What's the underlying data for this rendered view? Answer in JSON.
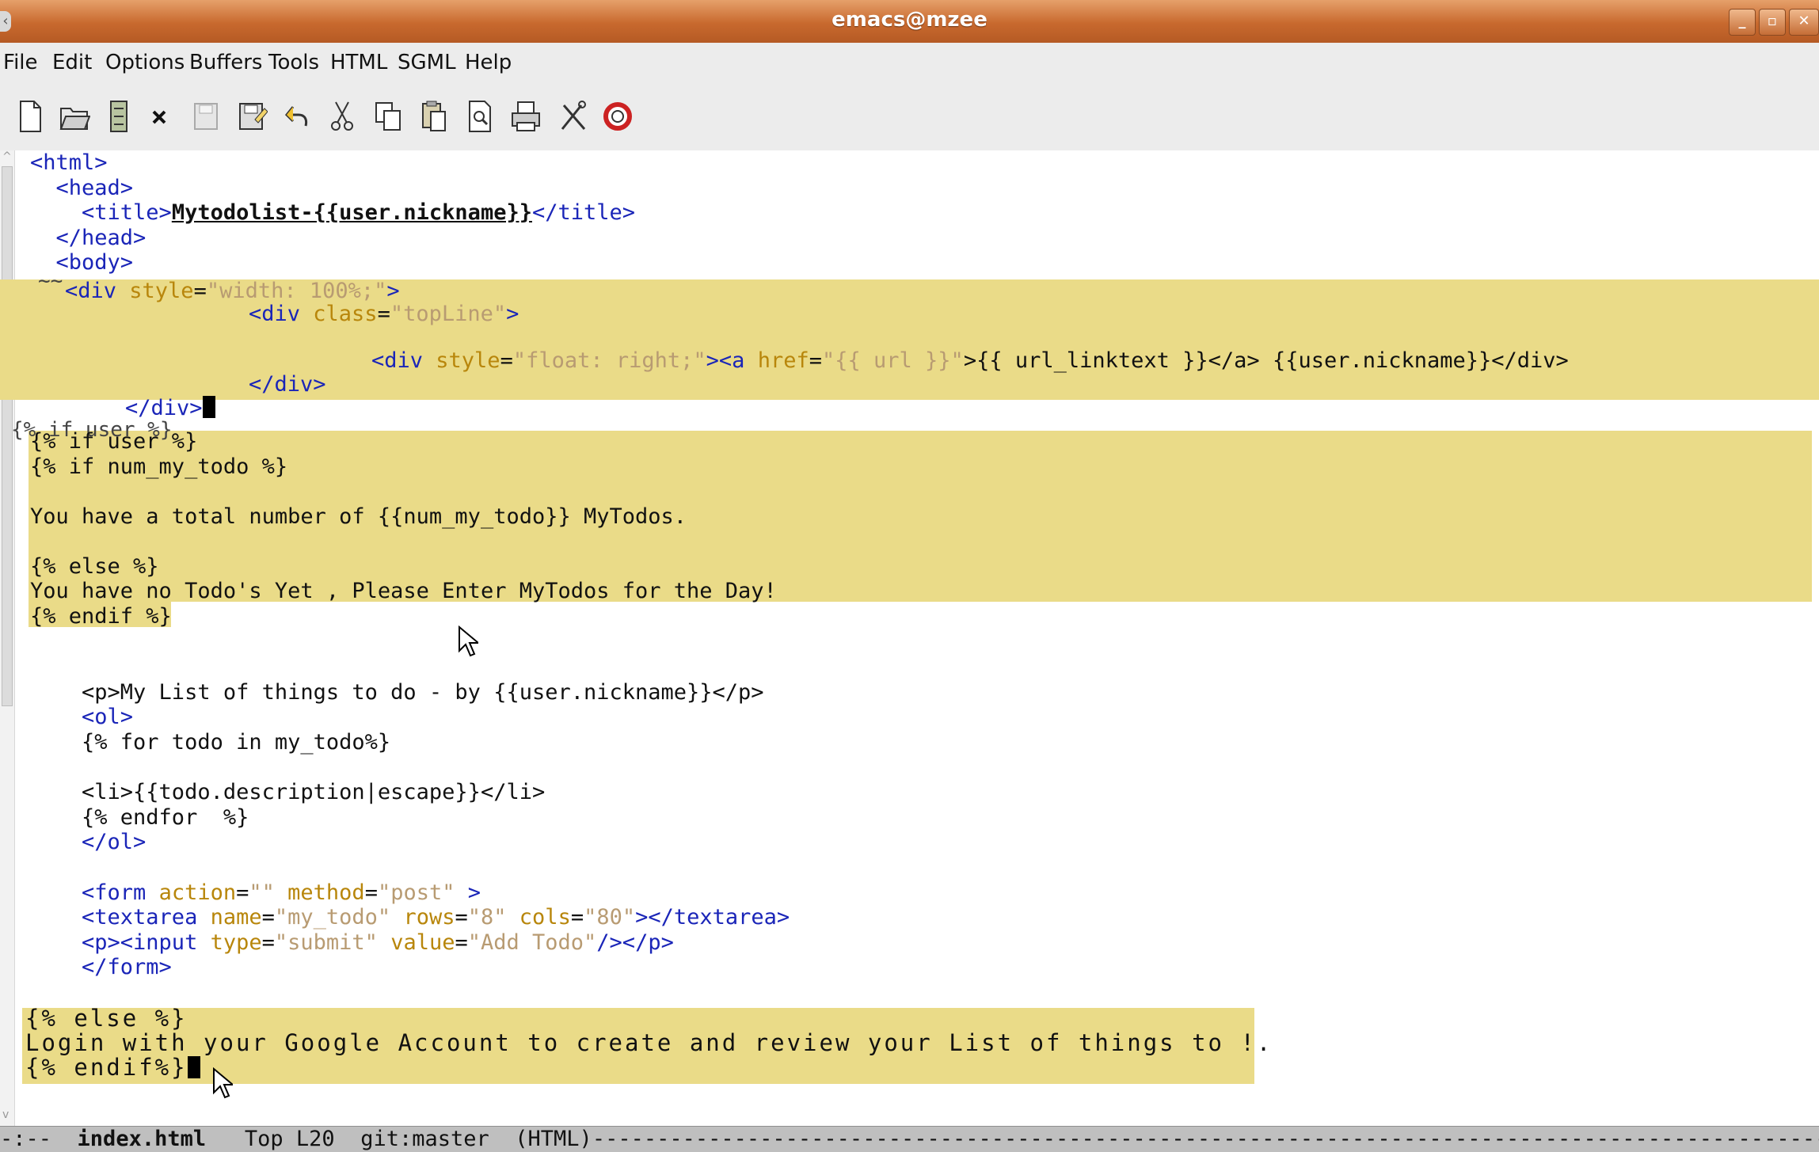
{
  "window": {
    "title": "emacs@mzee"
  },
  "menubar": {
    "items": [
      "File",
      "Edit",
      "Options",
      "Buffers",
      "Tools",
      "HTML",
      "SGML",
      "Help"
    ]
  },
  "toolbar": {
    "buttons": [
      "new-file-icon",
      "open-folder-icon",
      "open-directory-icon",
      "close-icon",
      "save-icon",
      "save-as-icon",
      "undo-icon",
      "cut-icon",
      "copy-icon",
      "paste-icon",
      "search-icon",
      "print-icon",
      "customize-icon",
      "help-icon"
    ]
  },
  "editor": {
    "lines": {
      "l1": "<html>",
      "l2": "  <head>",
      "l3_open": "    <title>",
      "l3_text": "Mytodolist-{{user.nickname}}",
      "l3_close": "</title>",
      "l4": "  </head>",
      "l5": "  <body>",
      "l6_a": "<div ",
      "l6_b": "style",
      "l6_c": "=",
      "l6_d": "\"width: 100%;\"",
      "l6_e": ">",
      "l7_a": "<div ",
      "l7_b": "class",
      "l7_c": "=",
      "l7_d": "\"topLine\"",
      "l7_e": ">",
      "l8_a": "<div ",
      "l8_b": "style",
      "l8_c": "=",
      "l8_d": "\"float: right;\"",
      "l8_e": "><a ",
      "l8_f": "href",
      "l8_g": "=",
      "l8_h": "\"{{ url }}\"",
      "l8_i": ">{{ url_linktext }}</a> {{user.nickname}}</div>",
      "l9": "</div>",
      "l10": "</div>",
      "l11": "{% if user %}",
      "l12": "{% if num_my_todo %}",
      "l13": "You have a total number of {{num_my_todo}} MyTodos.",
      "l14": "{% else %}",
      "l15": "You have no Todo's Yet , Please Enter MyTodos for the Day!",
      "l16": "{% endif %}",
      "l17": "    <p>My List of things to do - by {{user.nickname}}</p>",
      "l18": "    <ol>",
      "l19": "    {% for todo in my_todo%}",
      "l20": "    <li>{{todo.description|escape}}</li>",
      "l21": "    {% endfor  %}",
      "l22": "    </ol>",
      "l23_a": "    <form ",
      "l23_b": "action",
      "l23_c": "=",
      "l23_d": "\"\"",
      "l23_e": " ",
      "l23_f": "method",
      "l23_g": "=",
      "l23_h": "\"post\"",
      "l23_i": " >",
      "l24_a": "    <textarea ",
      "l24_b": "name",
      "l24_c": "=",
      "l24_d": "\"my_todo\"",
      "l24_e": " ",
      "l24_f": "rows",
      "l24_g": "=",
      "l24_h": "\"8\"",
      "l24_i": " ",
      "l24_j": "cols",
      "l24_k": "=",
      "l24_l": "\"80\"",
      "l24_m": "></textarea>",
      "l25_a": "    <p><input ",
      "l25_b": "type",
      "l25_c": "=",
      "l25_d": "\"submit\"",
      "l25_e": " ",
      "l25_f": "value",
      "l25_g": "=",
      "l25_h": "\"Add Todo\"",
      "l25_i": "/></p>",
      "l26": "    </form>",
      "l27": "{% else %}",
      "l28": "Login with your Google Account to create and review your List of things to !.",
      "l29": "{% endif%}"
    }
  },
  "modeline": {
    "flags": "-:--",
    "buffer_name": "index.html",
    "position": "Top L20",
    "vc": "git:master",
    "mode": "(HTML)",
    "fill": "--------------------------------------------------------------------------------------------------------"
  }
}
